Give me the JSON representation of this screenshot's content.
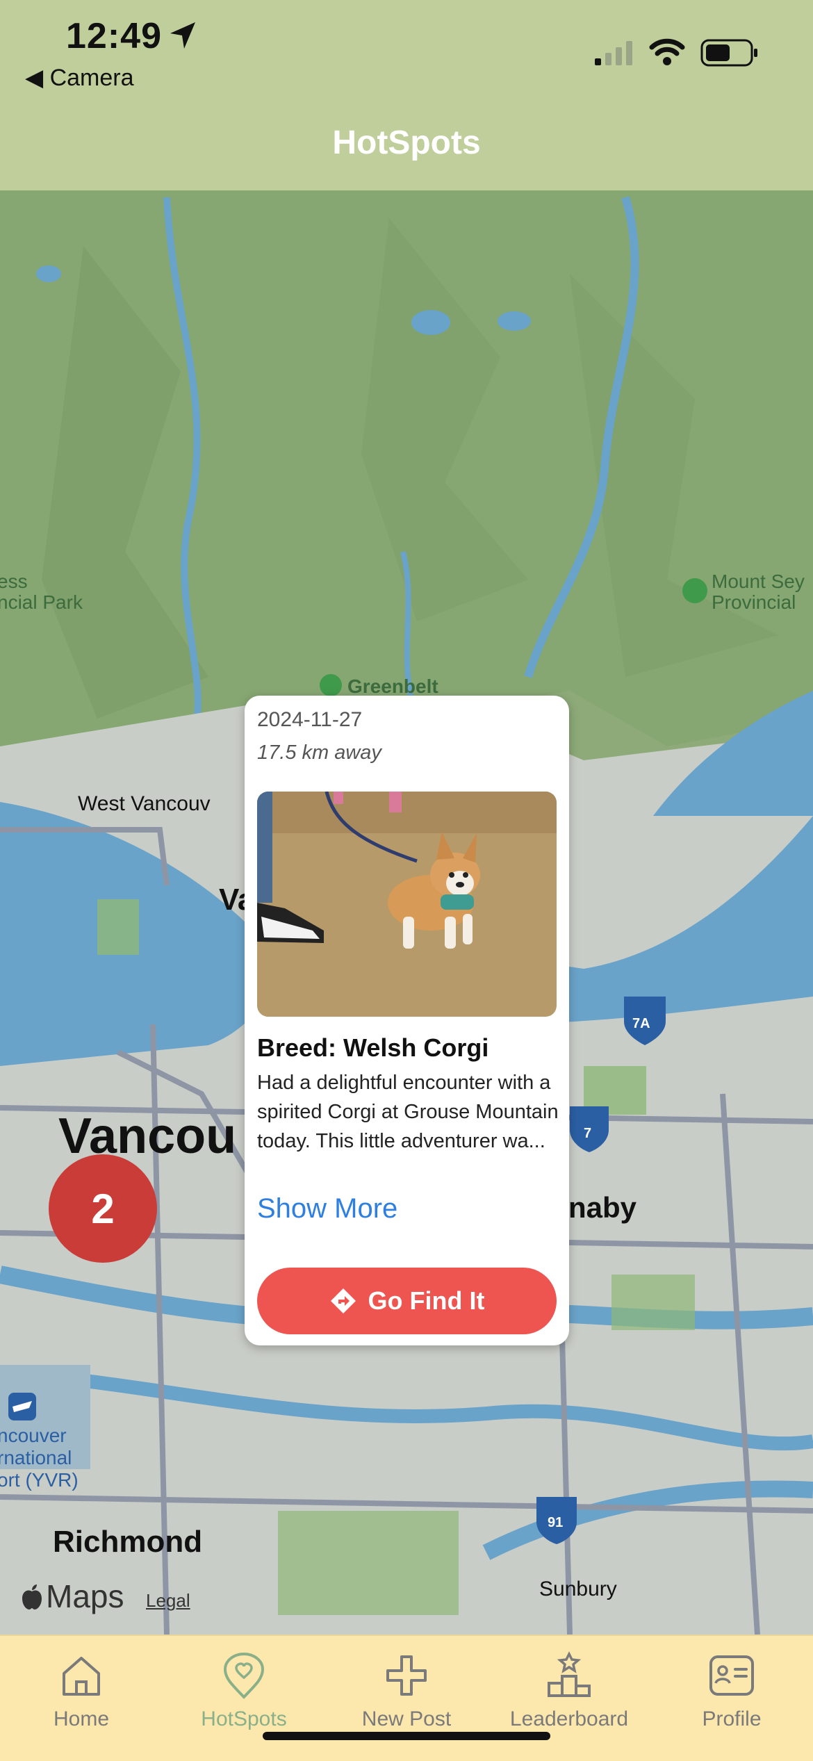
{
  "status_bar": {
    "time": "12:49",
    "back_label": "Camera",
    "icons": [
      "location-arrow-icon",
      "signal-icon",
      "wifi-icon",
      "battery-icon"
    ]
  },
  "header": {
    "title": "HotSpots"
  },
  "colors": {
    "header_bg": "#bfce9b",
    "tabbar_bg": "#fce7ad",
    "accent_red": "#ee5450",
    "cluster_red": "#c93c38",
    "link_blue": "#2f7fe0",
    "active_tab": "#8ab08a"
  },
  "map": {
    "labels": {
      "park_left": "ess\nncial Park",
      "mount_sey": "Mount Sey\nProvincial",
      "greenbelt": "Greenbelt",
      "west_vancouver": "West Vancouv",
      "va": "Va",
      "vancouver": "Vancou",
      "burnaby": "naby",
      "airport": "ncouver\nrnational\nort (YVR)",
      "richmond": "Richmond",
      "sunbury": "Sunbury",
      "route_7a": "7A",
      "route_7": "7",
      "route_91": "91",
      "maps_brand": "Maps",
      "legal": "Legal"
    },
    "cluster_count": "2"
  },
  "popup": {
    "date": "2024-11-27",
    "distance": "17.5 km away",
    "breed": "Breed: Welsh Corgi",
    "description": "Had a delightful encounter with a spirited Corgi at Grouse Mountain today. This little adventurer wa...",
    "show_more": "Show More",
    "go_button": "Go Find It"
  },
  "tabs": [
    {
      "label": "Home",
      "icon": "home-icon",
      "active": false
    },
    {
      "label": "HotSpots",
      "icon": "heart-pin-icon",
      "active": true
    },
    {
      "label": "New Post",
      "icon": "plus-icon",
      "active": false
    },
    {
      "label": "Leaderboard",
      "icon": "podium-icon",
      "active": false
    },
    {
      "label": "Profile",
      "icon": "profile-card-icon",
      "active": false
    }
  ]
}
